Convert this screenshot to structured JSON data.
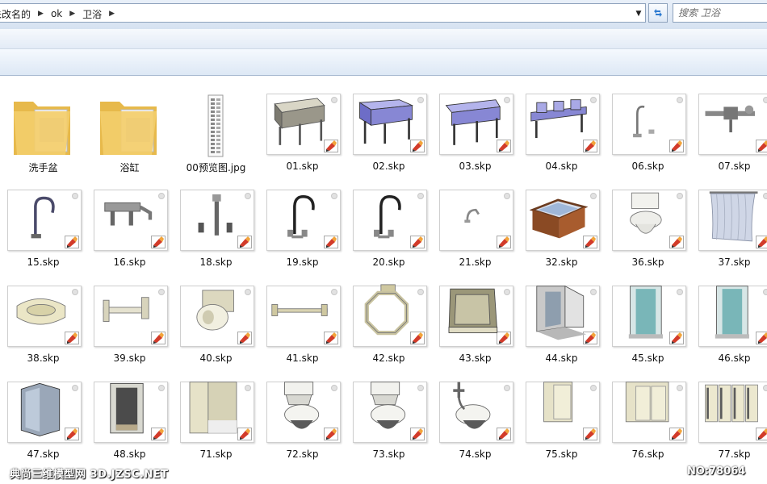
{
  "address": {
    "breadcrumbs": [
      "未改名的",
      "ok",
      "卫浴"
    ],
    "search_placeholder": "搜索 卫浴"
  },
  "icons": {
    "dropdown": "chevron-down-icon",
    "refresh": "refresh-icon",
    "breadcrumb_separator": "chevron-right-icon",
    "sketchup_badge": "sketchup-file-icon"
  },
  "colors": {
    "folder": "#f3cd6a",
    "model_blue": "#8787d4",
    "model_grey": "#c8c4b0",
    "glass": "#5aa6a8",
    "badge_red": "#d23b2a"
  },
  "files": {
    "items": [
      {
        "name": "洗手盆",
        "kind": "folder"
      },
      {
        "name": "浴缸",
        "kind": "folder"
      },
      {
        "name": "00预览图.jpg",
        "kind": "preview"
      },
      {
        "name": "01.skp",
        "kind": "counter-grey"
      },
      {
        "name": "02.skp",
        "kind": "counter-blue"
      },
      {
        "name": "03.skp",
        "kind": "counter-blue2"
      },
      {
        "name": "04.skp",
        "kind": "counter-blue3"
      },
      {
        "name": "06.skp",
        "kind": "faucet-small"
      },
      {
        "name": "07.skp",
        "kind": "faucet-wall"
      },
      {
        "name": "15.skp",
        "kind": "faucet-spring"
      },
      {
        "name": "16.skp",
        "kind": "tub-faucet"
      },
      {
        "name": "18.skp",
        "kind": "faucet-set"
      },
      {
        "name": "19.skp",
        "kind": "faucet-goose"
      },
      {
        "name": "20.skp",
        "kind": "faucet-goose"
      },
      {
        "name": "21.skp",
        "kind": "faucet-tiny"
      },
      {
        "name": "32.skp",
        "kind": "hot-tub"
      },
      {
        "name": "36.skp",
        "kind": "toilet"
      },
      {
        "name": "37.skp",
        "kind": "curtain"
      },
      {
        "name": "38.skp",
        "kind": "soap-dish"
      },
      {
        "name": "39.skp",
        "kind": "tp-holder"
      },
      {
        "name": "40.skp",
        "kind": "tp-roll"
      },
      {
        "name": "41.skp",
        "kind": "towel-bar"
      },
      {
        "name": "42.skp",
        "kind": "towel-ring"
      },
      {
        "name": "43.skp",
        "kind": "shower-stall"
      },
      {
        "name": "44.skp",
        "kind": "shower-corner"
      },
      {
        "name": "45.skp",
        "kind": "shower-glass"
      },
      {
        "name": "46.skp",
        "kind": "shower-glass"
      },
      {
        "name": "47.skp",
        "kind": "shower-neo"
      },
      {
        "name": "48.skp",
        "kind": "shower-dark"
      },
      {
        "name": "71.skp",
        "kind": "partition"
      },
      {
        "name": "72.skp",
        "kind": "toilet2"
      },
      {
        "name": "73.skp",
        "kind": "toilet2"
      },
      {
        "name": "74.skp",
        "kind": "toilet-flush"
      },
      {
        "name": "75.skp",
        "kind": "partition-small"
      },
      {
        "name": "76.skp",
        "kind": "partition-wide"
      },
      {
        "name": "77.skp",
        "kind": "partition-row"
      }
    ]
  },
  "watermark": {
    "left": "典尚三维模型网 3D.JZSC.NET",
    "right": "NO:78064"
  }
}
